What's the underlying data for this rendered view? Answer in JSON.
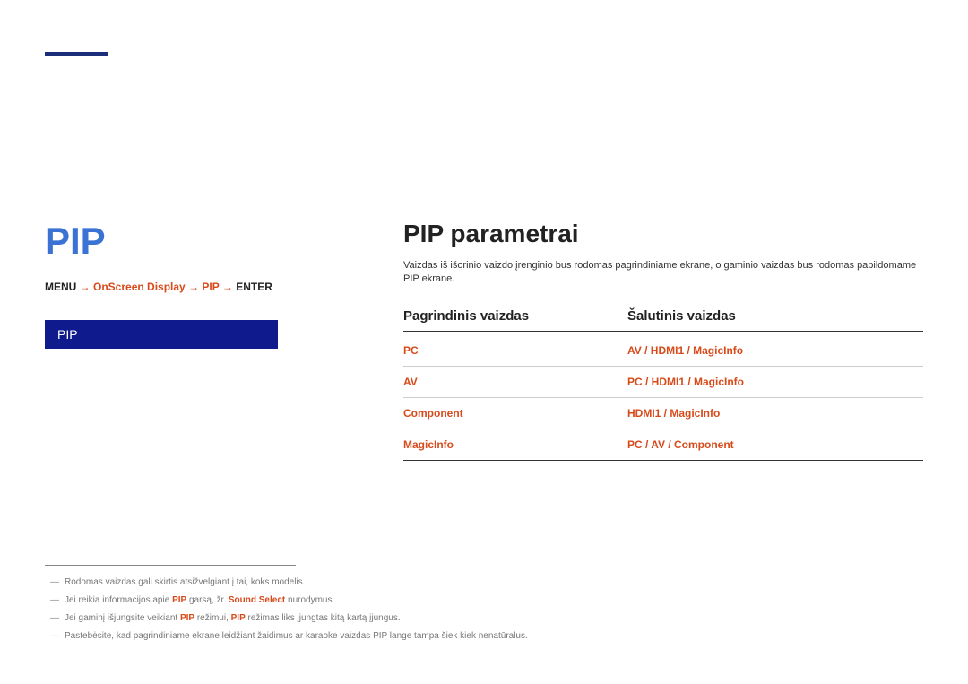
{
  "header": {
    "pp_heading": "PIP",
    "breadcrumb_parts": {
      "p1": "MENU",
      "p2": "OnScreen Display",
      "arrow1": " → ",
      "p3": "PIP",
      "arrow2": " → ",
      "p4": "ENTER"
    },
    "pip_box_label": "PIP"
  },
  "right": {
    "heading": "PIP parametrai",
    "desc": "Vaizdas iš išorinio vaizdo įrenginio bus rodomas pagrindiniame ekrane, o gaminio vaizdas bus rodomas papildomame PIP ekrane.",
    "th_left": "Pagrindinis vaizdas",
    "th_right": "Šalutinis vaizdas",
    "rows": [
      {
        "left": "PC",
        "right": "AV / HDMI1 / MagicInfo"
      },
      {
        "left": "AV",
        "right": "PC / HDMI1 / MagicInfo"
      },
      {
        "left": "Component",
        "right": "HDMI1 / MagicInfo"
      },
      {
        "left": "MagicInfo",
        "right": "PC / AV / Component"
      }
    ]
  },
  "footnotes": {
    "f1_text": "Rodomas vaizdas gali skirtis atsižvelgiant į tai, koks modelis.",
    "f2_p1": "Jei reikia informacijos apie ",
    "f2_o1": "PIP",
    "f2_p2": " garsą, žr. ",
    "f2_o2": "Sound Select",
    "f2_p3": " nurodymus.",
    "f3_p1": "Jei gaminį išjungsite veikiant ",
    "f3_o1": "PIP",
    "f3_p2": " režimui, ",
    "f3_o2": "PIP",
    "f3_p3": " režimas liks įjungtas kitą kartą įjungus.",
    "f4_text": "Pastebėsite, kad pagrindiniame ekrane leidžiant žaidimus ar karaoke vaizdas PIP lange tampa šiek kiek nenatūralus."
  }
}
